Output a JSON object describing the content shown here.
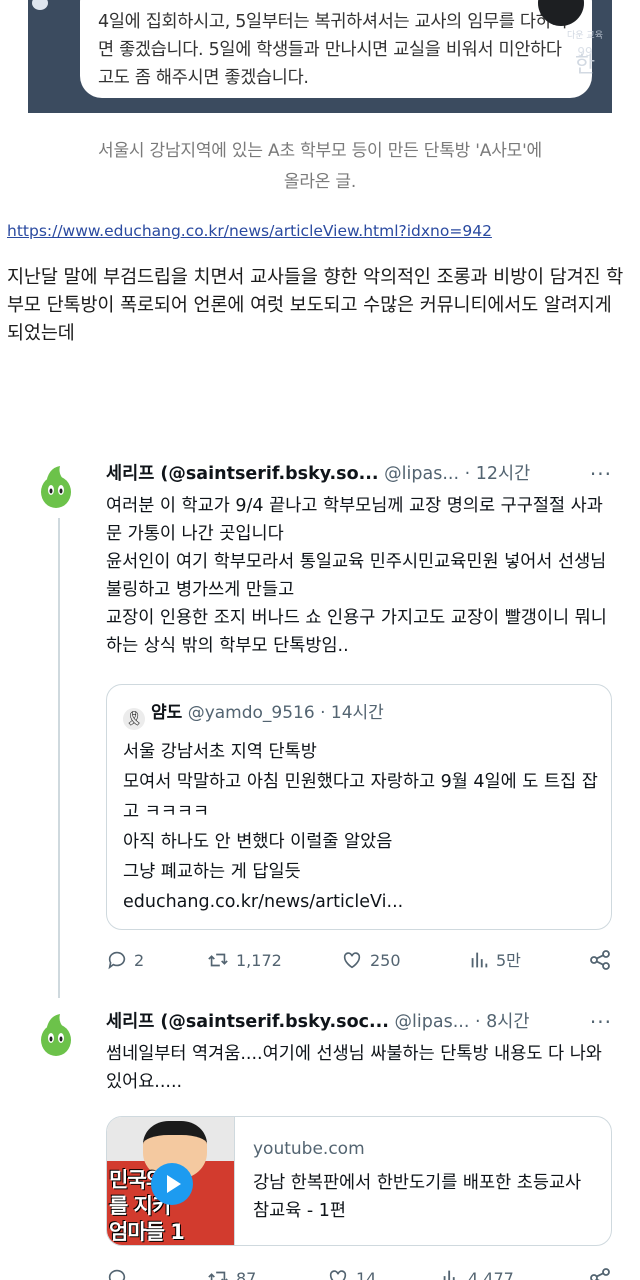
{
  "top_image": {
    "quote": "4일에 집회하시고, 5일부터는 복귀하셔서는 교사의 임무를 다하시면 좋겠습니다. 5일에 학생들과 만나시면 교실을 비워서 미안하다고도 좀 해주시면 좋겠습니다.",
    "logo_small": "다운 교육",
    "logo_num": "99",
    "logo_char": "한",
    "logo_sub": "~2"
  },
  "caption": {
    "line1": "서울시 강남지역에 있는 A초 학부모 등이 만든 단톡방 'A사모'에",
    "line2": "올라온 글."
  },
  "article_link": "https://www.educhang.co.kr/news/articleView.html?idxno=942",
  "body_text": "지난달 말에 부검드립을 치면서 교사들을 향한 악의적인 조롱과 비방이 담겨진 학부모 단톡방이 폭로되어 언론에 여럿 보도되고 수많은 커뮤니티에서도 알려지게 되었는데",
  "tweets": [
    {
      "name": "세리프 (@saintserif.bsky.so...",
      "handle": "@lipas...",
      "time": "· 12시간",
      "text": "여러분 이 학교가 9/4 끝나고 학부모님께 교장 명의로 구구절절 사과문 가통이 나간 곳입니다\n윤서인이 여기 학부모라서 통일교육 민주시민교육민원 넣어서 선생님 불링하고 병가쓰게 만들고\n교장이 인용한 조지 버나드 쇼 인용구 가지고도 교장이 빨갱이니 뭐니 하는 상식 밖의 학부모 단톡방임..",
      "quote": {
        "name": "얌도",
        "handle": "@yamdo_9516",
        "time": "· 14시간",
        "text": "서울 강남서초 지역 단톡방\n모여서 막말하고 아침 민원했다고 자랑하고 9월 4일에 도 트집 잡고 ㅋㅋㅋㅋ\n아직 하나도 안 변했다 이럴줄 알았음\n그냥 폐교하는 게 답일듯\neduchang.co.kr/news/articleVi..."
      },
      "replies": "2",
      "retweets": "1,172",
      "likes": "250",
      "views": "5만"
    },
    {
      "name": "세리프 (@saintserif.bsky.soc...",
      "handle": "@lipas...",
      "time": "· 8시간",
      "text": "썸네일부터 역겨움....여기에 선생님 싸불하는 단톡방 내용도 다 나와있어요.....",
      "card": {
        "domain": "youtube.com",
        "title": "강남 한복판에서 한반도기를 배포한 초등교사 참교육 - 1편",
        "thumb_text": "민국의\n를 지키\n엄마들 1"
      },
      "replies": "",
      "retweets": "87",
      "likes": "14",
      "views": "4,477"
    }
  ],
  "colors": {
    "link": "#2a4aa0",
    "muted": "#536471",
    "border": "#cfd9de",
    "avatar_green": "#6cc24a"
  }
}
